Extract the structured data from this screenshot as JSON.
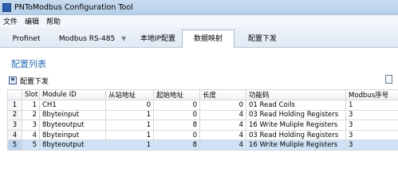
{
  "window": {
    "title": "PNToModbus Configuration Tool"
  },
  "menu": [
    "文件",
    "编辑",
    "帮助"
  ],
  "tabs": [
    "Profinet",
    "Modbus RS-485",
    "本地IP配置",
    "数据映射",
    "配置下发"
  ],
  "tab_arrow": "▼",
  "section_title": "配置列表",
  "toolbar": {
    "download_label": "配置下发"
  },
  "table": {
    "headers": [
      "",
      "Slot",
      "Module ID",
      "从站地址",
      "起始地址",
      "长度",
      "功能码",
      "Modbus序号"
    ],
    "rows": [
      [
        "1",
        "1",
        "CH1",
        "0",
        "0",
        "0",
        "01 Read Coils",
        "1"
      ],
      [
        "2",
        "2",
        "8byteinput",
        "1",
        "0",
        "4",
        "03 Read Holding Registers",
        "3"
      ],
      [
        "3",
        "3",
        "8byteoutput",
        "1",
        "8",
        "4",
        "16 Write Muliple Registers",
        "3"
      ],
      [
        "4",
        "4",
        "8byteinput",
        "1",
        "0",
        "4",
        "03 Read Holding Registers",
        "3"
      ],
      [
        "5",
        "5",
        "8byteoutput",
        "1",
        "8",
        "4",
        "16 Write Muliple Registers",
        "3"
      ]
    ],
    "selected_row": 4
  }
}
